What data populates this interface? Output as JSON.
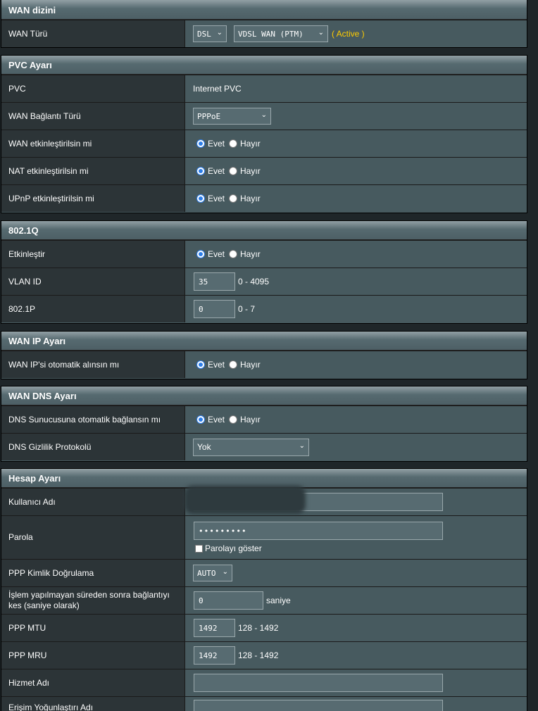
{
  "wan_index": {
    "title": "WAN dizini",
    "wan_type_label": "WAN Türü",
    "wan_type_select": "DSL",
    "wan_mode_select": "VDSL WAN (PTM)",
    "status": "( Active )"
  },
  "pvc": {
    "title": "PVC Ayarı",
    "pvc_label": "PVC",
    "pvc_value": "Internet PVC",
    "conn_type_label": "WAN Bağlantı Türü",
    "conn_type_select": "PPPoE",
    "wan_enable_label": "WAN etkinleştirilsin mi",
    "nat_enable_label": "NAT etkinleştirilsin mi",
    "upnp_enable_label": "UPnP etkinleştirilsin mi"
  },
  "radio": {
    "yes": "Evet",
    "no": "Hayır"
  },
  "vlan": {
    "title": "802.1Q",
    "enable_label": "Etkinleştir",
    "vlan_id_label": "VLAN ID",
    "vlan_id_value": "35",
    "vlan_id_range": "0 - 4095",
    "p_label": "802.1P",
    "p_value": "0",
    "p_range": "0 - 7"
  },
  "wan_ip": {
    "title": "WAN IP Ayarı",
    "auto_label": "WAN IP'si otomatik alınsın mı"
  },
  "wan_dns": {
    "title": "WAN DNS Ayarı",
    "auto_label": "DNS Sunucusuna otomatik bağlansın mı",
    "privacy_label": "DNS Gizlilik Protokolü",
    "privacy_select": "Yok"
  },
  "account": {
    "title": "Hesap Ayarı",
    "username_label": "Kullanıcı Adı",
    "password_label": "Parola",
    "password_value": "•••••••••",
    "show_password_label": "Parolayı göster",
    "auth_label": "PPP Kimlik Doğrulama",
    "auth_select": "AUTO",
    "idle_label": "İşlem yapılmayan süreden sonra bağlantıyı kes (saniye olarak)",
    "idle_value": "0",
    "idle_unit": "saniye",
    "mtu_label": "PPP MTU",
    "mtu_value": "1492",
    "mtu_range": "128 - 1492",
    "mru_label": "PPP MRU",
    "mru_value": "1492",
    "mru_range": "128 - 1492",
    "service_label": "Hizmet Adı",
    "concentrator_label": "Erişim Yoğunlaştırı Adı"
  },
  "colors": {
    "status": "#ffcc00",
    "radio_selected": "#2b7de9",
    "row_label_bg": "#2c3437",
    "row_value_bg": "#475a5f"
  }
}
